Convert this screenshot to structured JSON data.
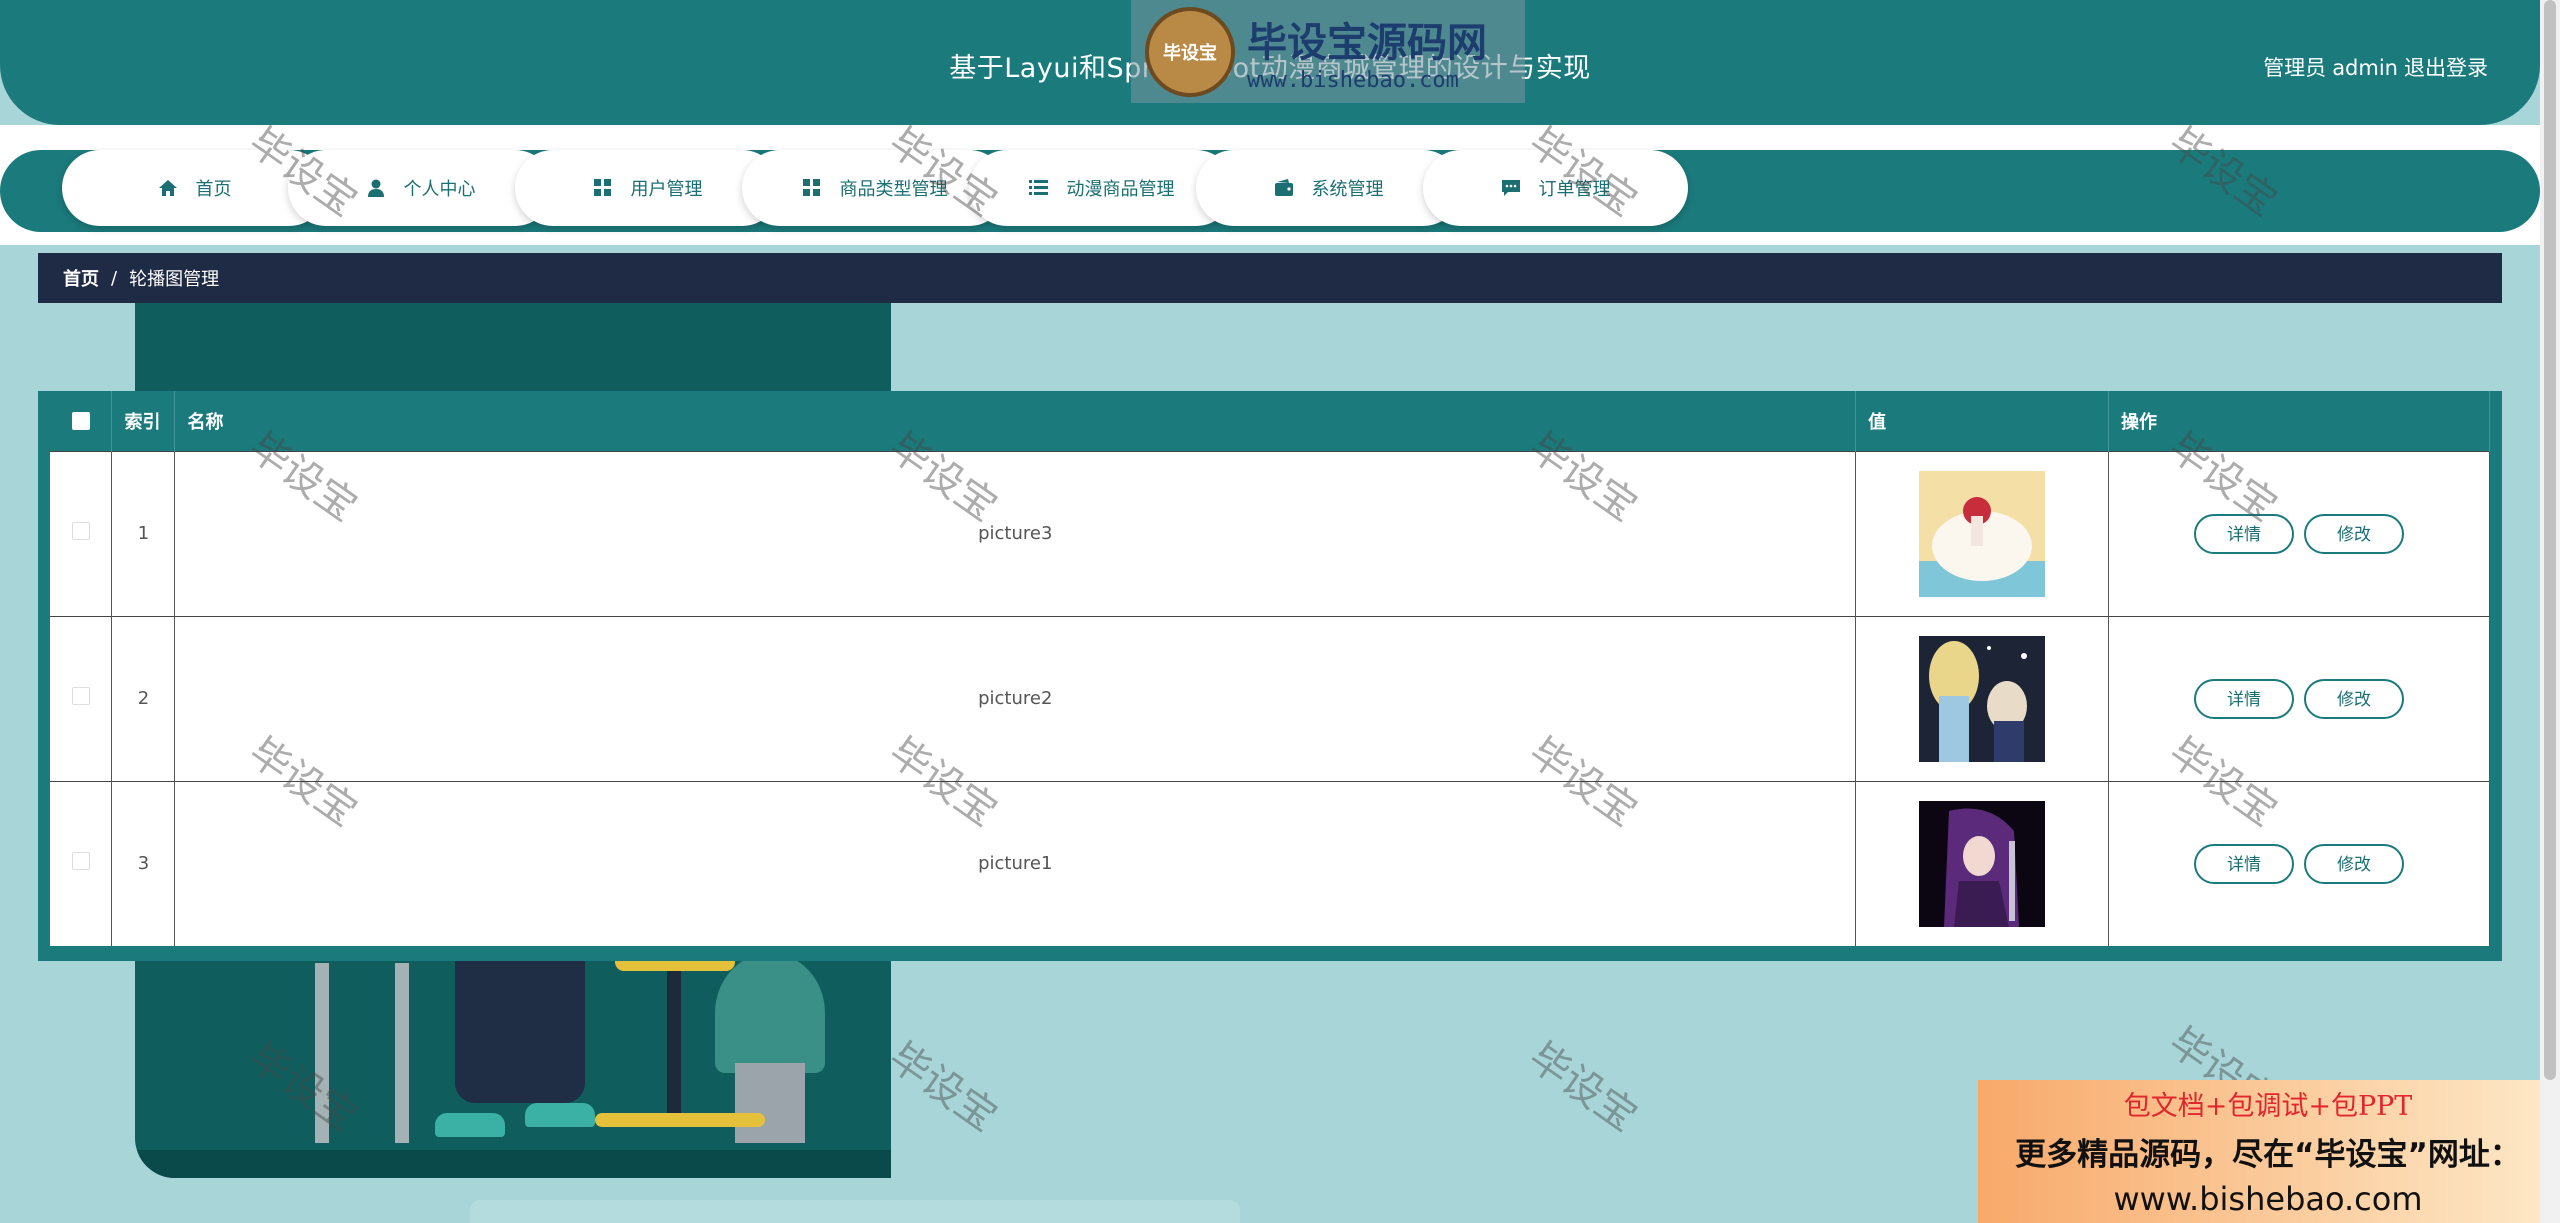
{
  "header": {
    "title": "基于Layui和SpringBoot动漫商城管理的设计与实现",
    "role_label": "管理员",
    "username": "admin",
    "logout_label": "退出登录"
  },
  "nav": {
    "items": [
      {
        "label": "首页",
        "icon": "home-icon"
      },
      {
        "label": "个人中心",
        "icon": "user-icon"
      },
      {
        "label": "用户管理",
        "icon": "grid-icon"
      },
      {
        "label": "商品类型管理",
        "icon": "grid-icon"
      },
      {
        "label": "动漫商品管理",
        "icon": "list-icon"
      },
      {
        "label": "系统管理",
        "icon": "wallet-icon"
      },
      {
        "label": "订单管理",
        "icon": "message-icon"
      }
    ]
  },
  "breadcrumb": {
    "home": "首页",
    "separator": "/",
    "current": "轮播图管理"
  },
  "table": {
    "columns": [
      "索引",
      "名称",
      "值",
      "操作"
    ],
    "rows": [
      {
        "index": "1",
        "name": "picture3"
      },
      {
        "index": "2",
        "name": "picture2"
      },
      {
        "index": "3",
        "name": "picture1"
      }
    ],
    "detail_label": "详情",
    "edit_label": "修改"
  },
  "watermark": {
    "text": "毕设宝",
    "logo_badge": "毕设宝",
    "logo_title": "毕设宝源码网",
    "logo_url": "www.bishebao.com"
  },
  "ad": {
    "line1": "包文档+包调试+包PPT",
    "line2": "更多精品源码，尽在“毕设宝”网址：",
    "line3": "www.bishebao.com"
  },
  "colors": {
    "primary": "#1b7a7c",
    "breadcrumb_bg": "#1f2b44",
    "page_bg": "#a8d6d8"
  }
}
